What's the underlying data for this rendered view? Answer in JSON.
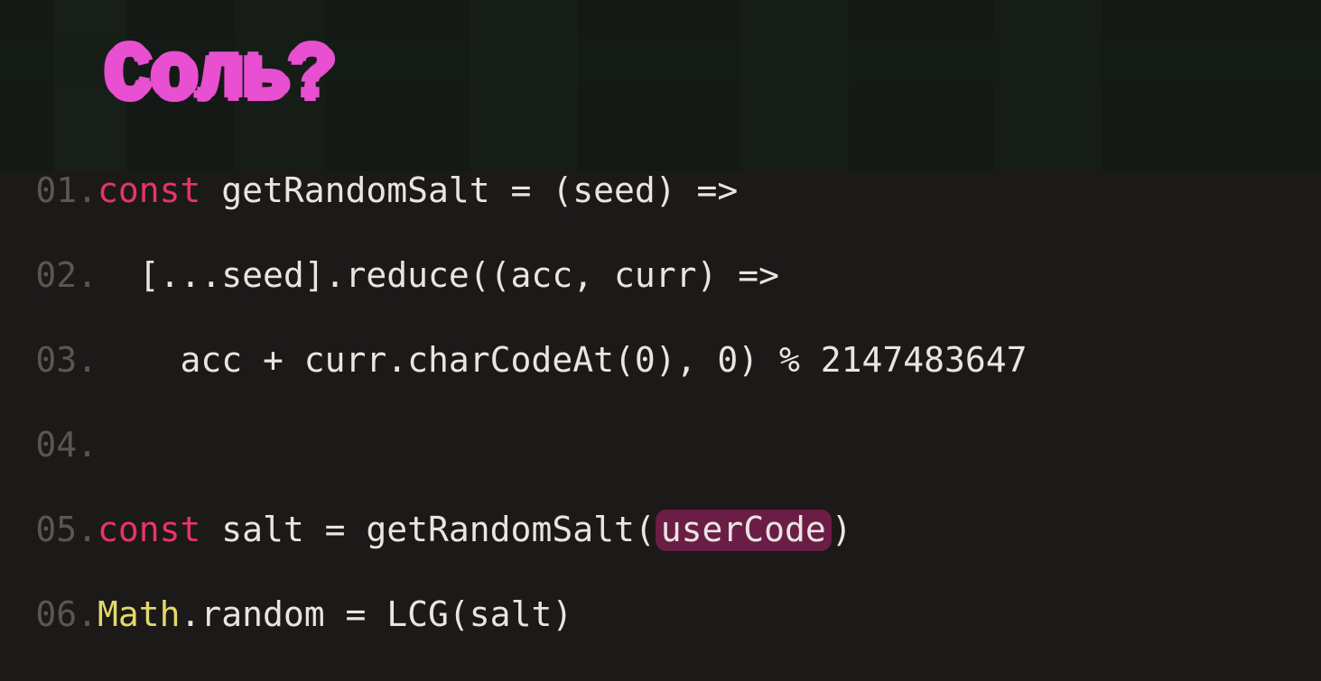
{
  "title": "Соль?",
  "colors": {
    "accent_pink": "#e84fd1",
    "keyword": "#e83564",
    "classname": "#e3d86a",
    "text": "#e9e5e1",
    "line_number": "#5b5654",
    "highlight_bg": "#6b1d45",
    "background": "#1c1919"
  },
  "code": {
    "lines": [
      {
        "num": "01",
        "segments": [
          {
            "t": "const",
            "c": "kw"
          },
          {
            "t": " getRandomSalt = (seed) =>",
            "c": "pl"
          }
        ]
      },
      {
        "num": "02",
        "segments": [
          {
            "t": "  [...seed].reduce((acc, curr) =>",
            "c": "pl"
          }
        ]
      },
      {
        "num": "03",
        "segments": [
          {
            "t": "    acc + curr.charCodeAt(0), 0) % 2147483647",
            "c": "pl"
          }
        ]
      },
      {
        "num": "04",
        "segments": [
          {
            "t": "",
            "c": "pl"
          }
        ]
      },
      {
        "num": "05",
        "segments": [
          {
            "t": "const",
            "c": "kw"
          },
          {
            "t": " salt = getRandomSalt(",
            "c": "pl"
          },
          {
            "t": "userCode",
            "c": "hl"
          },
          {
            "t": ")",
            "c": "pl"
          }
        ]
      },
      {
        "num": "06",
        "segments": [
          {
            "t": "Math",
            "c": "cls"
          },
          {
            "t": ".random = LCG(salt)",
            "c": "pl"
          }
        ]
      }
    ]
  }
}
